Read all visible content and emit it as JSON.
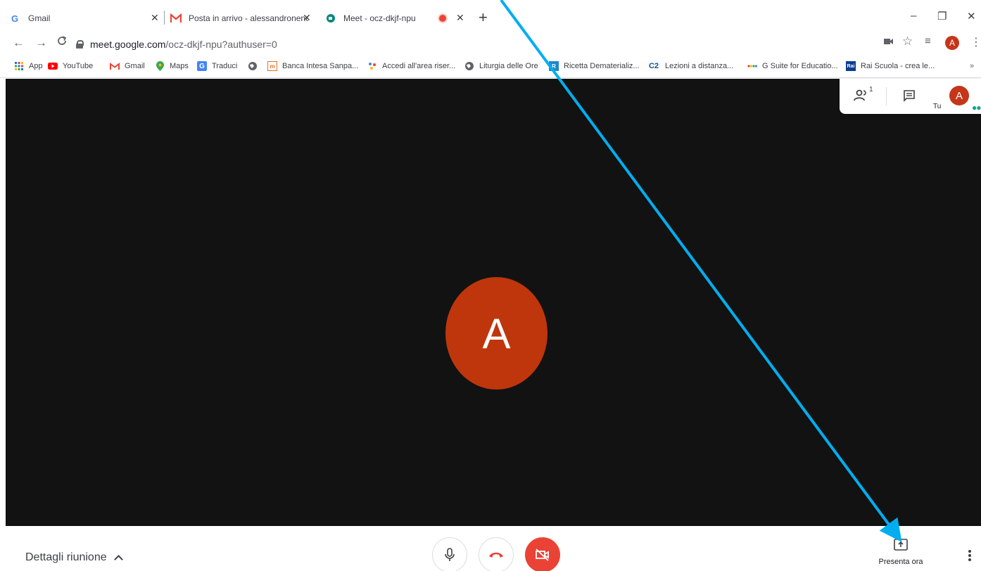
{
  "browser": {
    "tabs": [
      {
        "title": "Gmail",
        "favicon": "google-g-icon"
      },
      {
        "title": "Posta in arrivo - alessandronenci",
        "favicon": "gmail-m-icon"
      },
      {
        "title": "Meet - ocz-dkjf-npu",
        "favicon": "meet-icon",
        "recording": true,
        "active": true
      }
    ],
    "new_tab": "+",
    "window_controls": {
      "minimize": "–",
      "restore": "❐",
      "close": "✕"
    },
    "tab_close": "✕",
    "url_host": "meet.google.com",
    "url_path": "/ocz-dkjf-npu?authuser=0",
    "profile_initial": "A"
  },
  "bookmarks": [
    {
      "label": "App",
      "icon": "apps-grid-icon"
    },
    {
      "label": "YouTube",
      "icon": "youtube-icon"
    },
    {
      "label": "Gmail",
      "icon": "gmail-m-icon"
    },
    {
      "label": "Maps",
      "icon": "maps-pin-icon"
    },
    {
      "label": "Traduci",
      "icon": "translate-icon"
    },
    {
      "label": "",
      "icon": "globe-icon"
    },
    {
      "label": "Banca Intesa Sanpa...",
      "icon": "bank-icon"
    },
    {
      "label": "Accedi all'area riser...",
      "icon": "sparkle-icon"
    },
    {
      "label": "Liturgia delle Ore",
      "icon": "globe-icon"
    },
    {
      "label": "Ricetta Dematerializ...",
      "icon": "doc-icon"
    },
    {
      "label": "Lezioni a distanza...",
      "icon": "c2-icon"
    },
    {
      "label": "G Suite for Educatio...",
      "icon": "gsuite-icon"
    },
    {
      "label": "Rai Scuola - crea le...",
      "icon": "rai-icon"
    }
  ],
  "bookmarks_more": "»",
  "meet": {
    "participant_initial": "A",
    "participant_count": "1",
    "self_label": "Tu",
    "self_initial": "A",
    "details_label": "Dettagli riunione",
    "present_label": "Presenta ora"
  },
  "colors": {
    "stage": "#121212",
    "avatar": "#bf360c",
    "red_button": "#ea4335",
    "annotation_arrow": "#00aeef"
  }
}
